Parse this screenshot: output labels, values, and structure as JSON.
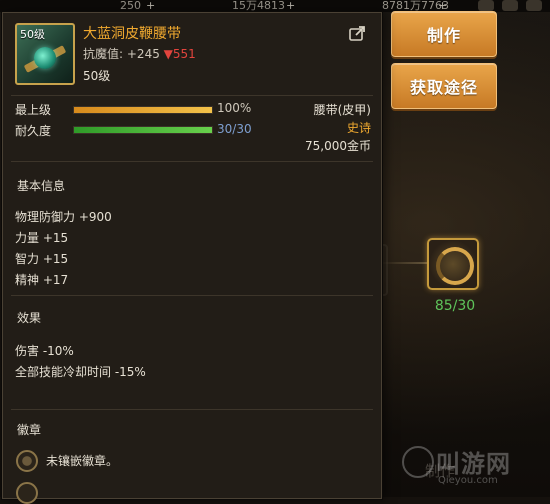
{
  "topbar": {
    "currency_1": "250",
    "currency_2": "15万4813",
    "currency_3": "8781万7763",
    "plus": "+"
  },
  "buttons": {
    "make": "制作",
    "source": "获取途径"
  },
  "recipe": {
    "progress": "85/30"
  },
  "item": {
    "level_badge": "50级",
    "name": "大蓝洞皮鞭腰带",
    "resist_label": "抗魔值:",
    "resist_plus": "+245",
    "resist_down_arrow": "▼",
    "resist_down": "551",
    "level": "50级",
    "max_level_label": "最上级",
    "max_level_value": "100%",
    "max_level_fraction": 1.0,
    "durability_label": "耐久度",
    "durability_value": "30/30",
    "durability_fraction": 1.0,
    "slot_type": "腰带(皮甲)",
    "rarity": "史诗",
    "price": "75,000金币"
  },
  "basic_info": {
    "title": "基本信息",
    "attrs": [
      "物理防御力 +900",
      "力量 +15",
      "智力 +15",
      "精神 +17"
    ]
  },
  "effects": {
    "title": "效果",
    "items": [
      "伤害 -10%",
      "全部技能冷却时间 -15%"
    ]
  },
  "badges": {
    "title": "徽章",
    "empty_text": "未镶嵌徽章。"
  },
  "watermark": {
    "text": "叫游网",
    "url": "Qieyou.com"
  },
  "colors": {
    "item_name": "#f0a92f",
    "rarity": "#f0a92f",
    "down": "#e2443d",
    "progress": "#5ec45a",
    "button": "#d98e33"
  }
}
